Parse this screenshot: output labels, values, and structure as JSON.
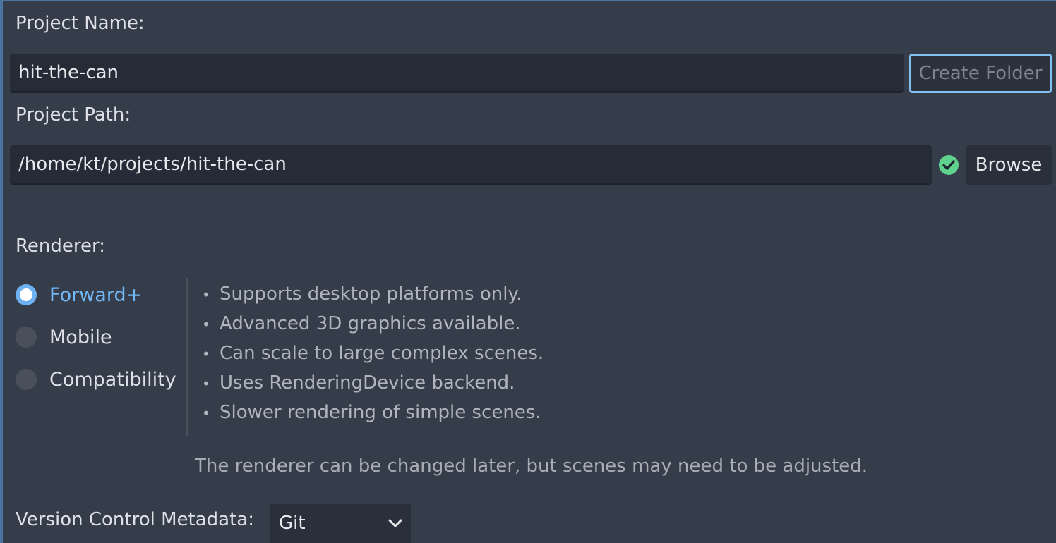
{
  "project_name": {
    "label": "Project Name:",
    "value": "hit-the-can",
    "create_folder_label": "Create Folder"
  },
  "project_path": {
    "label": "Project Path:",
    "value": "/home/kt/projects/hit-the-can",
    "status_icon": "check-circle-icon",
    "browse_label": "Browse"
  },
  "renderer": {
    "label": "Renderer:",
    "options": [
      {
        "label": "Forward+",
        "selected": true
      },
      {
        "label": "Mobile",
        "selected": false
      },
      {
        "label": "Compatibility",
        "selected": false
      }
    ],
    "features": [
      "Supports desktop platforms only.",
      "Advanced 3D graphics available.",
      "Can scale to large complex scenes.",
      "Uses RenderingDevice backend.",
      "Slower rendering of simple scenes."
    ],
    "note": "The renderer can be changed later, but scenes may need to be adjusted."
  },
  "version_control": {
    "label": "Version Control Metadata:",
    "selected": "Git"
  },
  "colors": {
    "background": "#363d4a",
    "accent": "#72b8f5",
    "success": "#5fd38d"
  }
}
